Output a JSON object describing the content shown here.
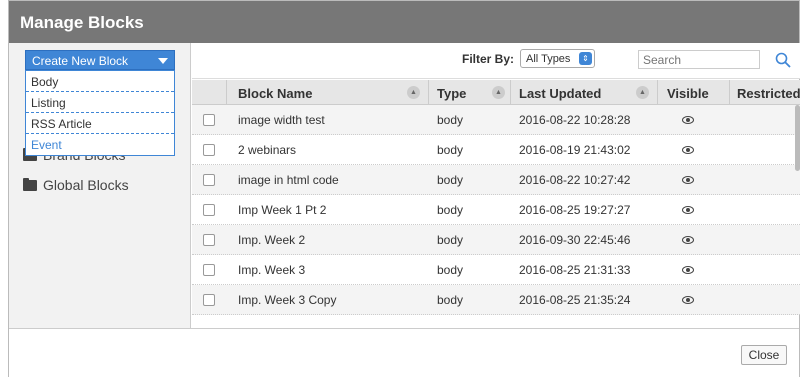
{
  "dialog": {
    "title": "Manage Blocks"
  },
  "create": {
    "label": "Create New Block",
    "options": [
      "Body",
      "Listing",
      "RSS Article",
      "Event"
    ]
  },
  "folders": [
    "Brand Blocks",
    "Global Blocks"
  ],
  "filter": {
    "label": "Filter By:",
    "selected": "All Types",
    "search_placeholder": "Search"
  },
  "table": {
    "headers": [
      "Block Name",
      "Type",
      "Last Updated",
      "Visible",
      "Restricted"
    ],
    "rows": [
      {
        "name": "image width test",
        "type": "body",
        "updated": "2016-08-22 10:28:28"
      },
      {
        "name": "2 webinars",
        "type": "body",
        "updated": "2016-08-19 21:43:02"
      },
      {
        "name": "image in html code",
        "type": "body",
        "updated": "2016-08-22 10:27:42"
      },
      {
        "name": "Imp Week 1 Pt 2",
        "type": "body",
        "updated": "2016-08-25 19:27:27"
      },
      {
        "name": "Imp. Week 2",
        "type": "body",
        "updated": "2016-09-30 22:45:46"
      },
      {
        "name": "Imp. Week 3",
        "type": "body",
        "updated": "2016-08-25 21:31:33"
      },
      {
        "name": "Imp. Week 3 Copy",
        "type": "body",
        "updated": "2016-08-25 21:35:24"
      }
    ]
  },
  "footer": {
    "close_label": "Close"
  },
  "colors": {
    "title_bar": "#777777",
    "accent": "#3f86d6",
    "row_alt": "#f4f4f4"
  },
  "icons": {
    "folder": "folder-icon",
    "search": "search-icon",
    "visible": "eye-icon",
    "sort": "sort-icon",
    "caret": "caret-down-icon"
  }
}
